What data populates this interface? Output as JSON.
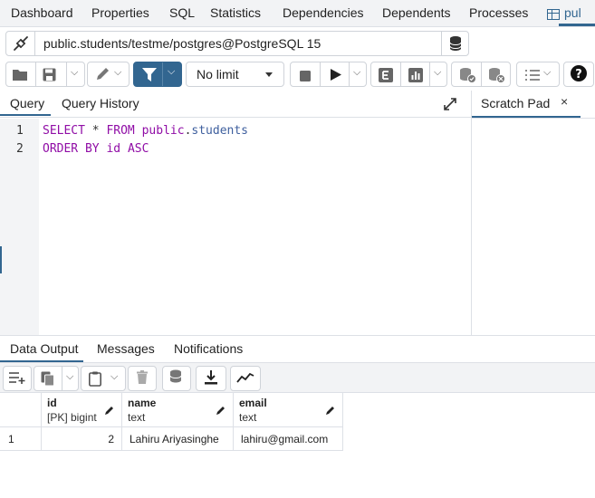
{
  "top_tabs": [
    "Dashboard",
    "Properties",
    "SQL",
    "Statistics",
    "Dependencies",
    "Dependents",
    "Processes",
    "pul"
  ],
  "connection": {
    "text": "public.students/testme/postgres@PostgreSQL 15"
  },
  "toolbar": {
    "limit": "No limit"
  },
  "editor": {
    "tabs": [
      "Query",
      "Query History"
    ],
    "line_numbers": [
      "1",
      "2"
    ],
    "line1": {
      "kw1": "SELECT",
      "star": "*",
      "kw2": "FROM",
      "schema": "public",
      "dot": ".",
      "table": "students"
    },
    "line2": {
      "kw1": "ORDER BY",
      "col": "id",
      "kw2": "ASC"
    }
  },
  "scratch": {
    "label": "Scratch Pad",
    "close": "×"
  },
  "output": {
    "tabs": [
      "Data Output",
      "Messages",
      "Notifications"
    ]
  },
  "grid": {
    "columns": [
      {
        "name": "id",
        "type": "[PK] bigint"
      },
      {
        "name": "name",
        "type": "text"
      },
      {
        "name": "email",
        "type": "text"
      }
    ],
    "rows": [
      {
        "num": "1",
        "id": "2",
        "name": "Lahiru Ariyasinghe",
        "email": "lahiru@gmail.com"
      }
    ]
  },
  "colors": {
    "accent": "#326690",
    "keyword": "#900da6",
    "identifier": "#3e5f9e"
  }
}
